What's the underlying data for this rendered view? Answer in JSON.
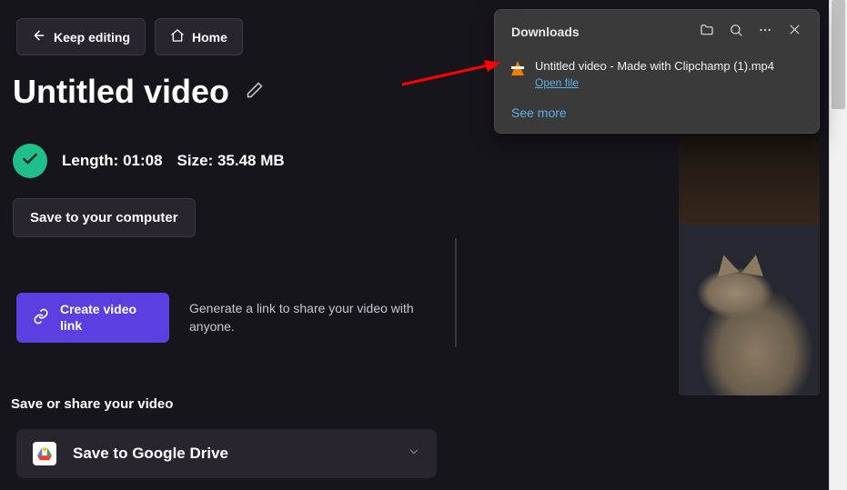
{
  "topbar": {
    "keep_editing": "Keep editing",
    "home": "Home"
  },
  "project": {
    "title": "Untitled video"
  },
  "status": {
    "length_label": "Length:",
    "length_value": "01:08",
    "size_label": "Size:",
    "size_value": "35.48 MB"
  },
  "save_button": "Save to your computer",
  "create_link": {
    "label": "Create video link",
    "description": "Generate a link to share your video with anyone."
  },
  "share": {
    "heading": "Save or share your video",
    "drive_label": "Save to Google Drive"
  },
  "downloads_panel": {
    "title": "Downloads",
    "item_filename": "Untitled video - Made with Clipchamp (1).mp4",
    "open_file": "Open file",
    "see_more": "See more"
  },
  "icons": {
    "arrow_left": "arrow-left-icon",
    "home": "home-icon",
    "pencil": "pencil-icon",
    "check": "check-icon",
    "link": "link-icon",
    "chevron_down": "chevron-down-icon",
    "folder": "folder-icon",
    "search": "search-icon",
    "more": "more-icon",
    "close": "close-icon"
  }
}
